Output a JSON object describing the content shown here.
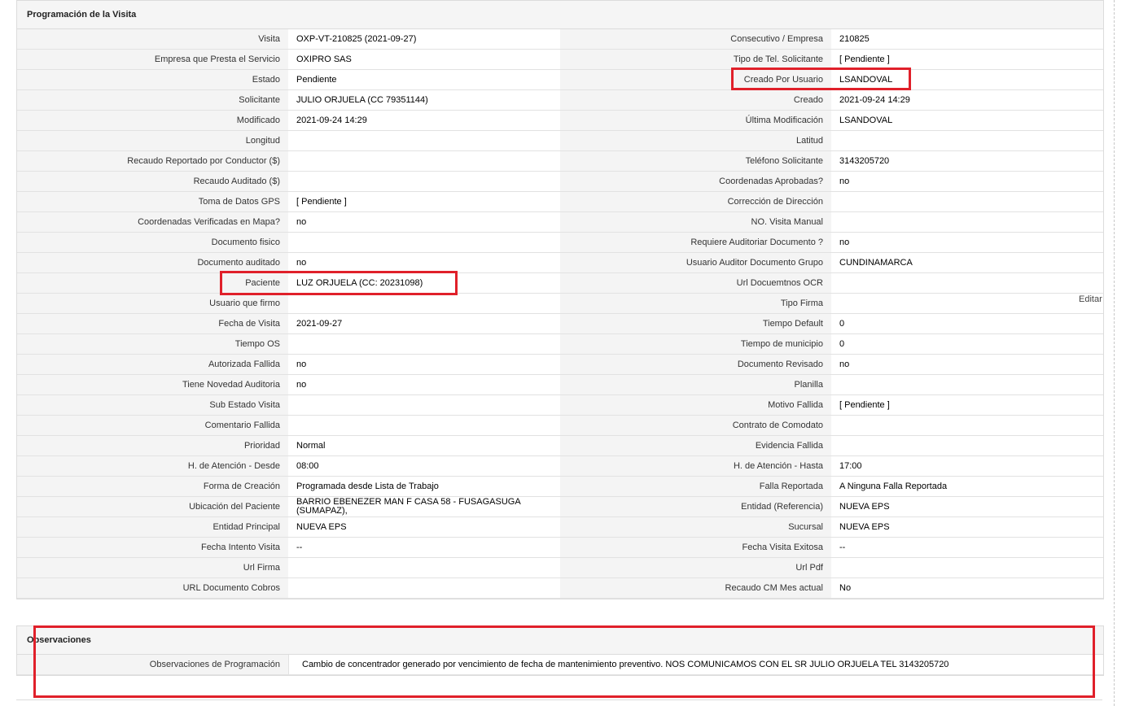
{
  "visit_panel": {
    "title": "Programación de la Visita",
    "rows": [
      [
        "Visita",
        "OXP-VT-210825 (2021-09-27)",
        "Consecutivo / Empresa",
        "210825"
      ],
      [
        "Empresa que Presta el Servicio",
        "OXIPRO SAS",
        "Tipo de Tel. Solicitante",
        "[ Pendiente ]"
      ],
      [
        "Estado",
        "Pendiente",
        "Creado Por Usuario",
        "LSANDOVAL"
      ],
      [
        "Solicitante",
        "JULIO ORJUELA (CC 79351144)",
        "Creado",
        "2021-09-24 14:29"
      ],
      [
        "Modificado",
        "2021-09-24 14:29",
        "Última Modificación",
        " LSANDOVAL"
      ],
      [
        "Longitud",
        "",
        "Latitud",
        ""
      ],
      [
        "Recaudo Reportado por Conductor ($)",
        "",
        "Teléfono Solicitante",
        "3143205720"
      ],
      [
        "Recaudo Auditado ($)",
        "",
        "Coordenadas Aprobadas?",
        " no"
      ],
      [
        "Toma de Datos GPS",
        "[ Pendiente ]",
        "Corrección de Dirección",
        ""
      ],
      [
        "Coordenadas Verificadas en Mapa?",
        " no",
        "NO. Visita Manual",
        ""
      ],
      [
        "Documento fisico",
        "",
        "Requiere Auditoriar Documento ?",
        " no"
      ],
      [
        "Documento auditado",
        " no",
        "Usuario Auditor Documento Grupo",
        "CUNDINAMARCA"
      ],
      [
        "Paciente",
        "LUZ ORJUELA (CC: 20231098)",
        "Url Docuemtnos OCR",
        ""
      ],
      [
        "Usuario que firmo",
        "",
        "Tipo Firma",
        ""
      ],
      [
        "Fecha de Visita",
        " 2021-09-27",
        "Tiempo Default",
        "0"
      ],
      [
        "Tiempo OS",
        "",
        "Tiempo de municipio",
        "0"
      ],
      [
        "Autorizada Fallida",
        " no",
        "Documento Revisado",
        " no"
      ],
      [
        "Tiene Novedad Auditoria",
        " no",
        "Planilla",
        ""
      ],
      [
        "Sub Estado Visita",
        "",
        "Motivo Fallida",
        "[ Pendiente ]"
      ],
      [
        "Comentario Fallida",
        "",
        "Contrato de Comodato",
        ""
      ],
      [
        "Prioridad",
        "Normal",
        "Evidencia Fallida",
        ""
      ],
      [
        "H. de Atención - Desde",
        "08:00",
        "H. de Atención - Hasta",
        "17:00"
      ],
      [
        "Forma de Creación",
        "Programada desde Lista de Trabajo",
        "Falla Reportada",
        "A Ninguna Falla Reportada"
      ],
      [
        "Ubicación del Paciente",
        "BARRIO EBENEZER MAN F CASA 58 - FUSAGASUGA (SUMAPAZ),",
        "Entidad (Referencia)",
        "NUEVA EPS"
      ],
      [
        "Entidad Principal",
        "NUEVA EPS",
        "Sucursal",
        "NUEVA EPS"
      ],
      [
        "Fecha Intento Visita",
        " --",
        "Fecha Visita Exitosa",
        " --"
      ],
      [
        "Url Firma",
        "",
        "Url Pdf",
        ""
      ],
      [
        "URL Documento Cobros",
        "",
        "Recaudo CM Mes actual",
        "No"
      ]
    ],
    "edit_link": "Editar"
  },
  "observations_panel": {
    "title": "Observaciones",
    "label": "Observaciones de Programación",
    "value": "Cambio de concentrador generado por vencimiento de fecha de mantenimiento preventivo. NOS COMUNICAMOS CON EL SR JULIO ORJUELA TEL 3143205720"
  },
  "highlight_color": "#e0202a"
}
